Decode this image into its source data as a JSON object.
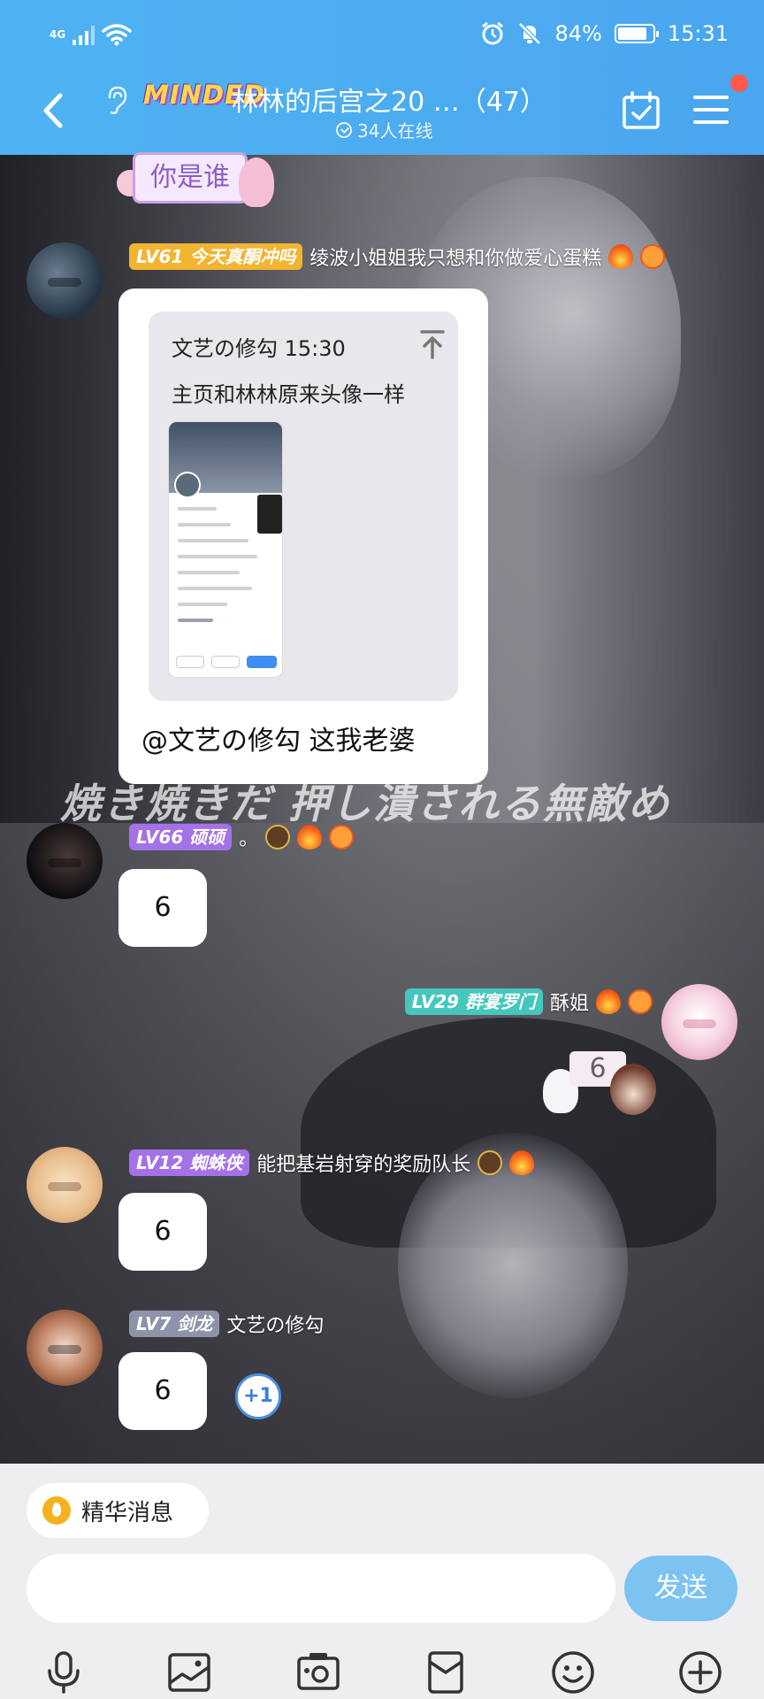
{
  "status_bar": {
    "network": "4G",
    "battery": "84%",
    "battery_level": 0.84,
    "time": "15:31"
  },
  "header": {
    "brand": "MINDED",
    "title": "林林的后宫之20 …（47）",
    "online": "34人在线",
    "icons": [
      "back-icon",
      "ear-icon",
      "calendar-check-icon",
      "menu-icon"
    ]
  },
  "background": {
    "subtitle": "焼き焼きだ 押し潰される無敵め"
  },
  "sticker_top": {
    "text": "你是谁"
  },
  "messages": [
    {
      "badge": "LV61 今天真酮冲吗",
      "title": "绫波小姐姐我只想和你做爱心蛋糕",
      "quote": {
        "header": "文艺の修勾 15:30",
        "text": "主页和林林原来头像一样"
      },
      "reply": "@文艺の修勾 这我老婆"
    },
    {
      "badge": "LV66 硕硕",
      "title": "。",
      "text": "6"
    },
    {
      "badge": "LV29 群宴罗门",
      "title": "酥姐",
      "sticker_text": "6"
    },
    {
      "badge": "LV12 蜘蛛侠",
      "title": "能把基岩射穿的奖励队长",
      "text": "6"
    },
    {
      "badge": "LV7 剑龙",
      "title": "文艺の修勾",
      "text": "6",
      "plus_one": "+1"
    }
  ],
  "bottom": {
    "essence_label": "精华消息",
    "input_placeholder": "",
    "send_label": "发送",
    "tools": [
      "mic-icon",
      "image-icon",
      "camera-icon",
      "red-packet-icon",
      "emoji-icon",
      "plus-icon"
    ]
  }
}
